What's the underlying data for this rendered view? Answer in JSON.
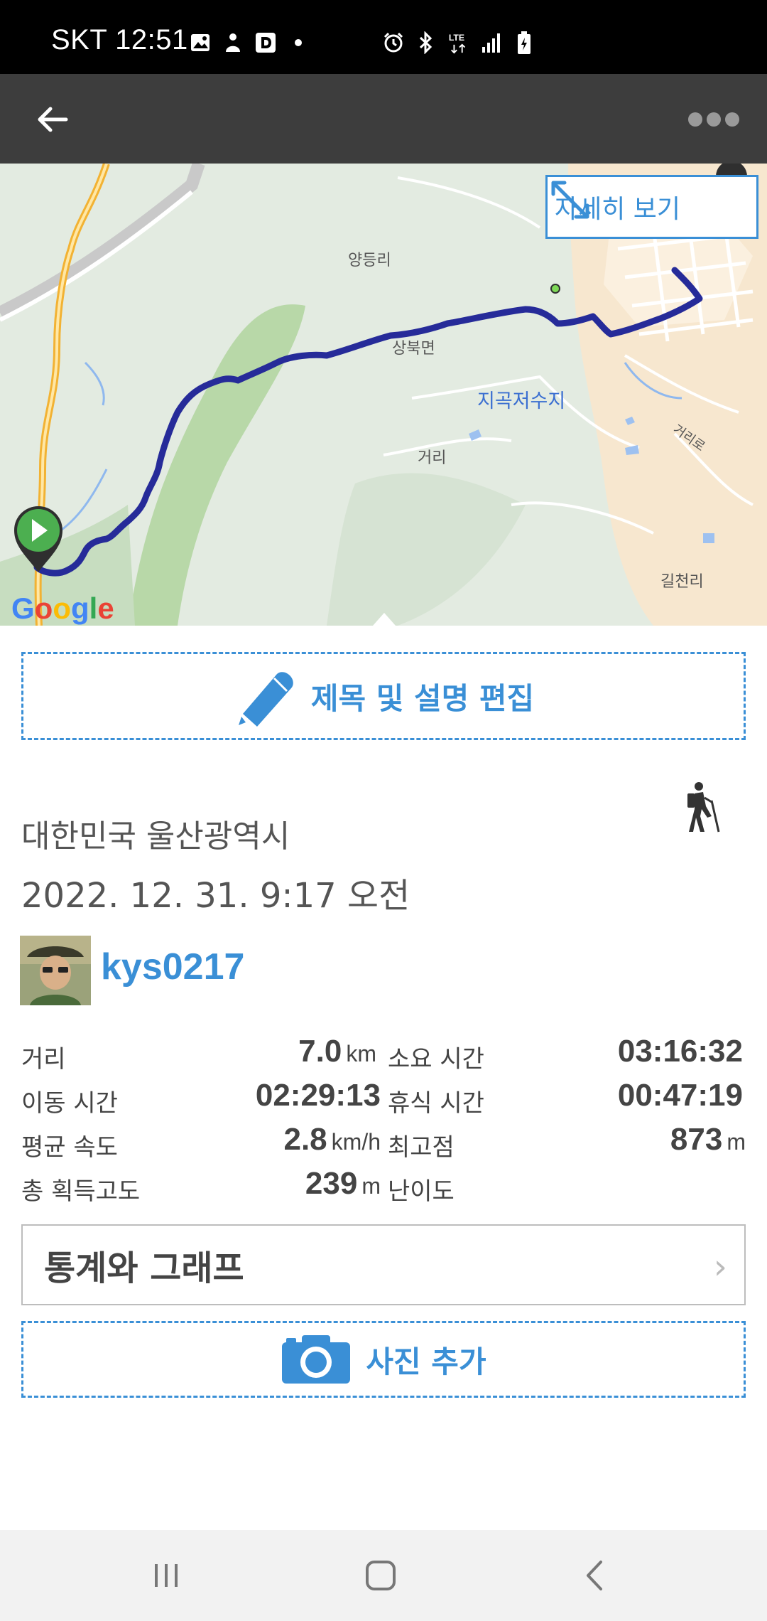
{
  "status_bar": {
    "carrier_time": "SKT 12:51",
    "left_icons": [
      "gallery-icon",
      "person-icon",
      "d-app-icon",
      "dot-icon"
    ],
    "right_icons": [
      "alarm-icon",
      "bluetooth-icon",
      "lte-icon",
      "signal-icon",
      "battery-charging-icon"
    ]
  },
  "toolbar": {
    "back_icon": "arrow-left-icon",
    "more_icon": "more-dots-icon"
  },
  "map": {
    "detail_button_label": "자세히 보기",
    "labels": [
      "양등리",
      "상북면",
      "지곡저수지",
      "거리",
      "거리로",
      "길천리"
    ],
    "provider": "Google",
    "route_color": "#262b99",
    "start_marker_color": "#4caf50"
  },
  "edit_button": {
    "label": "제목 및 설명 편집",
    "icon": "pencil-icon"
  },
  "activity": {
    "location": "대한민국 울산광역시",
    "datetime": "2022. 12. 31. 9:17 오전",
    "type_icon": "hiking-icon",
    "username": "kys0217"
  },
  "stats": {
    "distance": {
      "label": "거리",
      "value": "7.0",
      "unit": "km"
    },
    "total_time": {
      "label": "소요 시간",
      "value": "03:16:32"
    },
    "moving_time": {
      "label": "이동 시간",
      "value": "02:29:13"
    },
    "rest_time": {
      "label": "휴식 시간",
      "value": "00:47:19"
    },
    "avg_speed": {
      "label": "평균 속도",
      "value": "2.8",
      "unit": "km/h"
    },
    "max_elevation": {
      "label": "최고점",
      "value": "873",
      "unit": "m"
    },
    "elevation_gain": {
      "label": "총 획득고도",
      "value": "239",
      "unit": "m"
    },
    "difficulty": {
      "label": "난이도",
      "value": ""
    }
  },
  "graph_button": {
    "label": "통계와 그래프",
    "chevron": "›"
  },
  "photo_button": {
    "label": "사진 추가",
    "icon": "camera-icon"
  },
  "nav_bar": {
    "icons": [
      "recent-apps-icon",
      "home-icon",
      "back-icon"
    ]
  },
  "colors": {
    "accent": "#3a8fd6",
    "toolbar": "#3d3d3d",
    "status_bar": "#000000"
  }
}
